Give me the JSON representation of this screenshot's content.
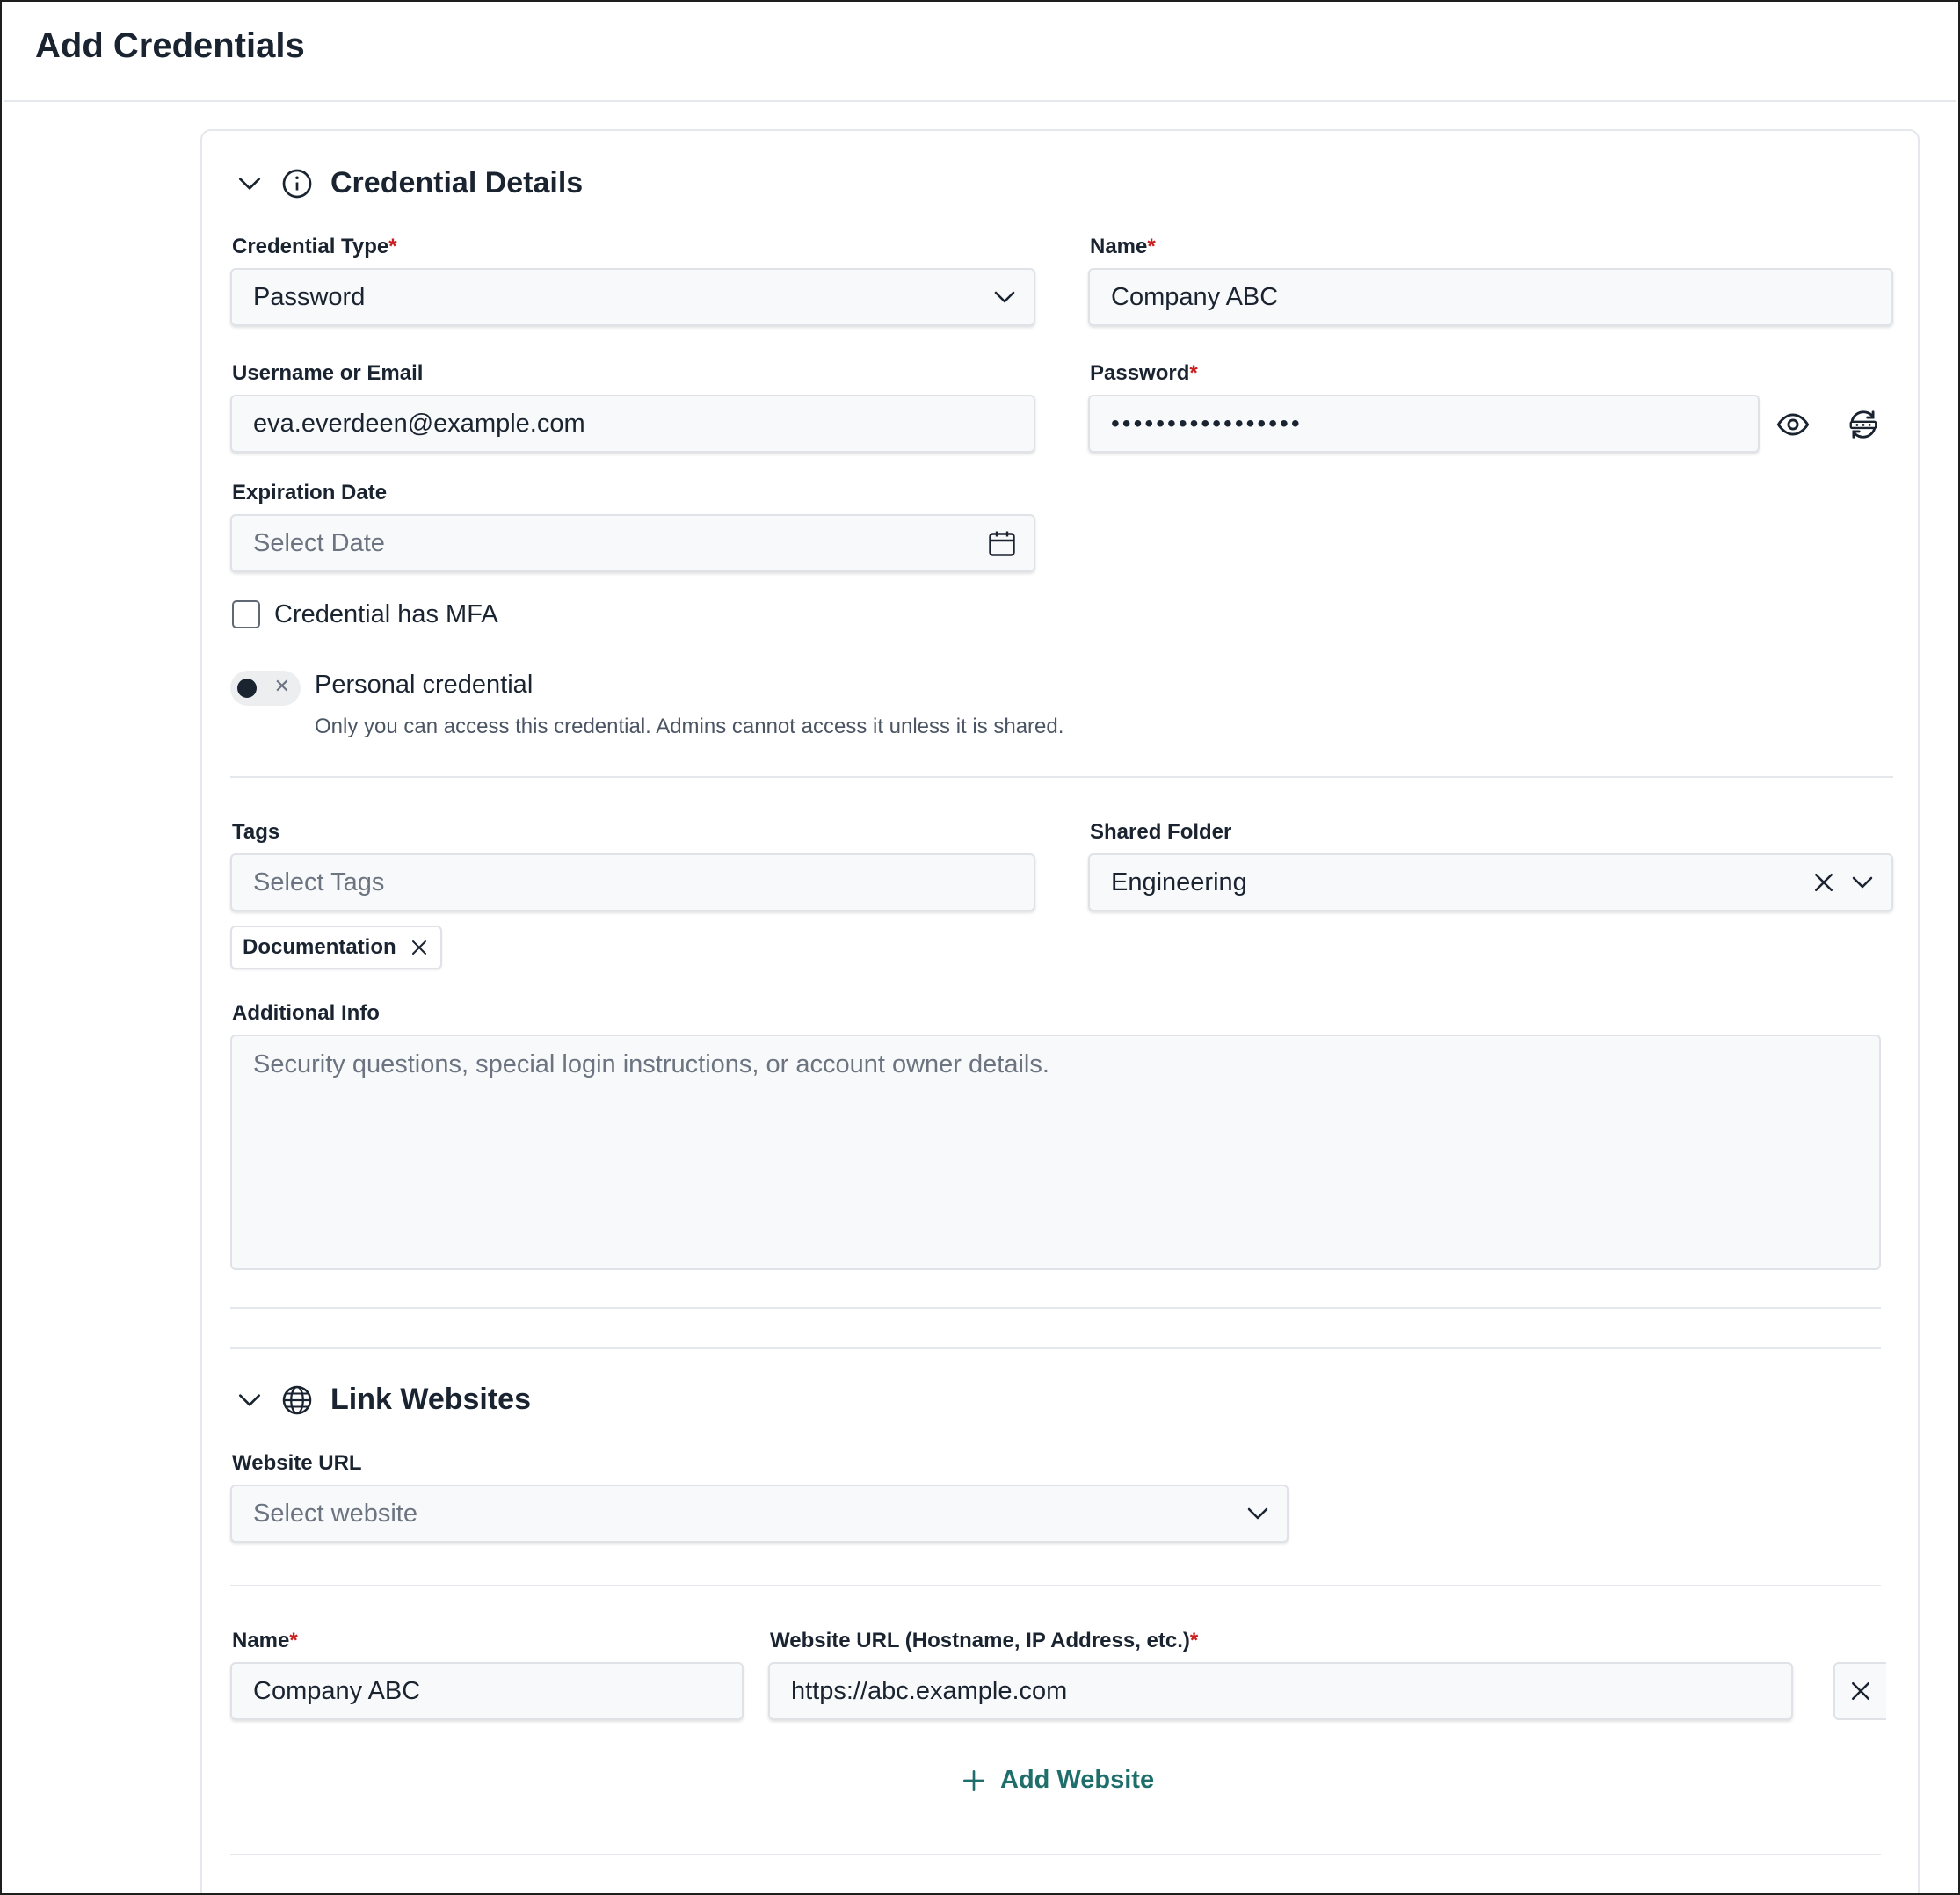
{
  "page": {
    "title": "Add Credentials"
  },
  "credential_details": {
    "section_title": "Credential Details",
    "credential_type": {
      "label": "Credential Type",
      "required": "*",
      "value": "Password"
    },
    "name": {
      "label": "Name",
      "required": "*",
      "value": "Company ABC"
    },
    "username": {
      "label": "Username or Email",
      "value": "eva.everdeen@example.com"
    },
    "password": {
      "label": "Password",
      "required": "*",
      "value": "•••••••••••••••••"
    },
    "expiration": {
      "label": "Expiration Date",
      "placeholder": "Select Date"
    },
    "mfa": {
      "label": "Credential has MFA",
      "checked": false
    },
    "personal": {
      "label": "Personal credential",
      "description": "Only you can access this credential. Admins cannot access it unless it is shared.",
      "enabled": false
    },
    "tags": {
      "label": "Tags",
      "placeholder": "Select Tags",
      "selected": [
        "Documentation"
      ]
    },
    "shared_folder": {
      "label": "Shared Folder",
      "value": "Engineering"
    },
    "additional_info": {
      "label": "Additional Info",
      "placeholder": "Security questions, special login instructions, or account owner details."
    }
  },
  "link_websites": {
    "section_title": "Link Websites",
    "website_url": {
      "label": "Website URL",
      "placeholder": "Select website"
    },
    "entry": {
      "name_label": "Name",
      "name_required": "*",
      "name_value": "Company ABC",
      "url_label": "Website URL (Hostname, IP Address, etc.)",
      "url_required": "*",
      "url_value": "https://abc.example.com"
    },
    "add_button": "Add Website"
  },
  "colors": {
    "accent": "#1f6e6b",
    "required": "#c81e1e",
    "text": "#1a2330",
    "border": "#dfe3e8"
  }
}
